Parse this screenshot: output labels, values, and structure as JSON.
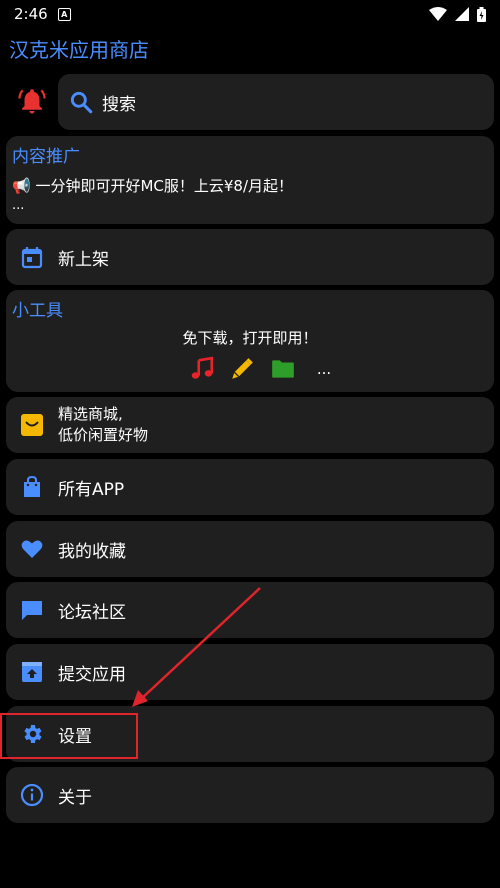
{
  "status_bar": {
    "time": "2:46"
  },
  "app_title": "汉克米应用商店",
  "search": {
    "label": "搜索"
  },
  "promo": {
    "title": "内容推广",
    "line1": "📢 一分钟即可开好MC服！上云¥8/月起！",
    "line2": "..."
  },
  "menu": {
    "new_shelf": "新上架",
    "tools_title": "小工具",
    "tools_desc": "免下载，打开即用！",
    "tools_more": "...",
    "shop_line1": "精选商城,",
    "shop_line2": "低价闲置好物",
    "all_apps": "所有APP",
    "favorites": "我的收藏",
    "forum": "论坛社区",
    "submit_app": "提交应用",
    "settings": "设置",
    "about": "关于"
  },
  "colors": {
    "accent": "#4a8dff",
    "card": "#1f1f1f",
    "highlight": "#e0242b",
    "bell": "#e8322f"
  }
}
